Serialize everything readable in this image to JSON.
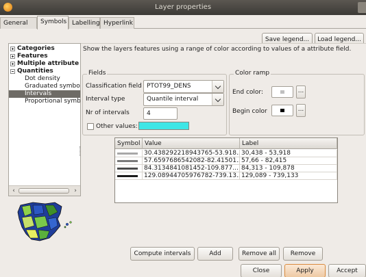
{
  "window": {
    "title": "Layer properties"
  },
  "tabs": [
    {
      "label": "General",
      "active": false
    },
    {
      "label": "Symbols",
      "active": true
    },
    {
      "label": "Labelling",
      "active": false
    },
    {
      "label": "Hyperlink",
      "active": false
    }
  ],
  "legend_buttons": {
    "save": "Save legend...",
    "load": "Load legend..."
  },
  "tree": {
    "items": [
      {
        "label": "Categories",
        "kind": "plus"
      },
      {
        "label": "Features",
        "kind": "plus"
      },
      {
        "label": "Multiple attribute",
        "kind": "plus"
      },
      {
        "label": "Quantities",
        "kind": "minus"
      },
      {
        "label": "Dot density",
        "kind": "child"
      },
      {
        "label": "Graduated symbo",
        "kind": "child"
      },
      {
        "label": "Intervals",
        "kind": "child",
        "selected": true
      },
      {
        "label": "Proportional symb",
        "kind": "child"
      }
    ]
  },
  "description": "Show the layers features using a range of color according to values of a attribute field.",
  "fields": {
    "legend": "Fields",
    "classification_label": "Classification field",
    "classification_value": "PTOT99_DENS",
    "interval_type_label": "Interval type",
    "interval_type_value": "Quantile interval",
    "nr_intervals_label": "Nr of intervals",
    "nr_intervals_value": "4",
    "other_values_label": "Other values:",
    "other_values_color": "#3ee6e6"
  },
  "color_ramp": {
    "legend": "Color ramp",
    "end_label": "End color:",
    "end_color": "#bfbfbf",
    "begin_label": "Begin color",
    "begin_color": "#000000",
    "dots": "..."
  },
  "table": {
    "headers": {
      "symbol": "Symbol",
      "value": "Value",
      "label": "Label"
    },
    "rows": [
      {
        "value": "30.438292218943765-53.918...",
        "label": "30,438 - 53,918",
        "color": "#a8a8a8"
      },
      {
        "value": "57.6597686542082-82.41501...",
        "label": "57,66 - 82,415",
        "color": "#7a7a7a"
      },
      {
        "value": "84.3134841081452-109.877...",
        "label": "84,313 - 109,878",
        "color": "#4a4a4a"
      },
      {
        "value": "129.08944705976782-739.13...",
        "label": "129,089 - 739,133",
        "color": "#1a1a1a"
      }
    ]
  },
  "actions": {
    "compute": "Compute intervals",
    "add": "Add",
    "remove_all": "Remove all",
    "remove": "Remove"
  },
  "footer": {
    "close": "Close",
    "apply": "Apply",
    "accept": "Accept"
  }
}
